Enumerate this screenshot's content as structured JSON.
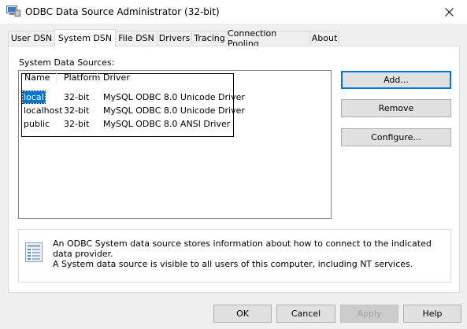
{
  "window": {
    "title": "ODBC Data Source Administrator (32-bit)",
    "close_icon": "close-icon"
  },
  "tabs": [
    {
      "label": "User DSN",
      "active": false
    },
    {
      "label": "System DSN",
      "active": true
    },
    {
      "label": "File DSN",
      "active": false
    },
    {
      "label": "Drivers",
      "active": false
    },
    {
      "label": "Tracing",
      "active": false
    },
    {
      "label": "Connection Pooling",
      "active": false
    },
    {
      "label": "About",
      "active": false
    }
  ],
  "system_dsn": {
    "section_label": "System Data Sources:",
    "columns": [
      "Name",
      "Platform",
      "Driver"
    ],
    "rows": [
      {
        "name": "local",
        "platform": "32-bit",
        "driver": "MySQL ODBC 8.0 Unicode Driver",
        "selected": true
      },
      {
        "name": "localhost",
        "platform": "32-bit",
        "driver": "MySQL ODBC 8.0 Unicode Driver",
        "selected": false
      },
      {
        "name": "public",
        "platform": "32-bit",
        "driver": "MySQL ODBC 8.0 ANSI Driver",
        "selected": false
      }
    ],
    "buttons": {
      "add": "Add...",
      "remove": "Remove",
      "configure": "Configure..."
    },
    "info": {
      "icon": "data-source-icon",
      "line1": "An ODBC System data source stores information about how to connect to the indicated data provider.",
      "line2": "A System data source is visible to all users of this computer, including NT services."
    }
  },
  "footer_buttons": {
    "ok": "OK",
    "cancel": "Cancel",
    "apply": "Apply",
    "help": "Help"
  },
  "colors": {
    "selection": "#0078d7",
    "default_button_border": "#0078d7",
    "dialog_background": "#f0f0f0"
  }
}
